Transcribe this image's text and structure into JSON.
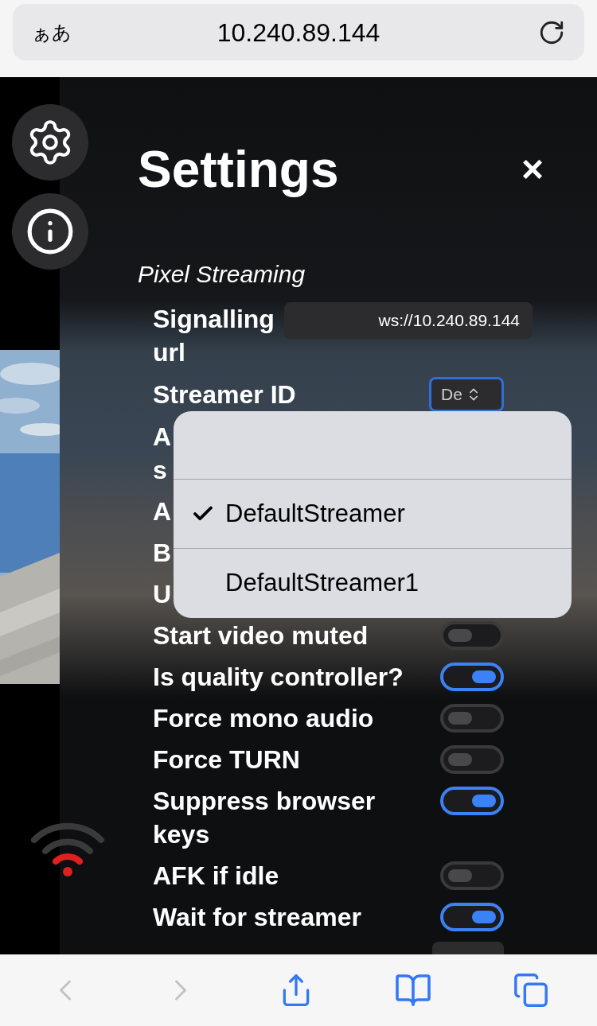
{
  "browser": {
    "text_size": "ぁあ",
    "address": "10.240.89.144"
  },
  "settings": {
    "title": "Settings",
    "close": "×",
    "section": "Pixel Streaming",
    "rows": [
      {
        "kind": "text",
        "label": "Signalling url",
        "value": "ws://10.240.89.144"
      },
      {
        "kind": "select",
        "label": "Streamer ID",
        "value": "De",
        "focused": true
      },
      {
        "kind": "covered",
        "label": "A\ns"
      },
      {
        "kind": "covered",
        "label": "A"
      },
      {
        "kind": "covered",
        "label": "B"
      },
      {
        "kind": "covered",
        "label": "U"
      },
      {
        "kind": "toggle",
        "label": "Start video muted",
        "on": false
      },
      {
        "kind": "toggle",
        "label": "Is quality controller?",
        "on": true
      },
      {
        "kind": "toggle",
        "label": "Force mono audio",
        "on": false
      },
      {
        "kind": "toggle",
        "label": "Force TURN",
        "on": false
      },
      {
        "kind": "toggle",
        "label": "Suppress browser keys",
        "on": true
      },
      {
        "kind": "toggle",
        "label": "AFK if idle",
        "on": false
      },
      {
        "kind": "toggle",
        "label": "Wait for streamer",
        "on": true
      },
      {
        "kind": "number"
      }
    ]
  },
  "menu": {
    "options": [
      {
        "label": "DefaultStreamer",
        "selected": true
      },
      {
        "label": "DefaultStreamer1",
        "selected": false
      }
    ]
  },
  "toolbar": {
    "back_disabled": true,
    "forward_disabled": true
  }
}
